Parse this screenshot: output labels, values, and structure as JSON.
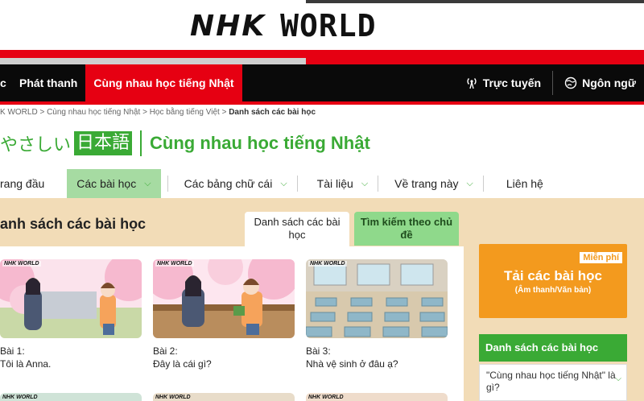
{
  "header": {
    "logo_nhk": "NHK",
    "logo_world": "WORLD"
  },
  "main_nav": {
    "items": [
      {
        "label": "c"
      },
      {
        "label": "Phát thanh"
      },
      {
        "label": "Cùng nhau học tiếng Nhật",
        "active": true
      }
    ],
    "live_label": "Trực tuyến",
    "language_label": "Ngôn ngữ"
  },
  "breadcrumb": {
    "items": [
      "K WORLD",
      "Cùng nhau học tiếng Nhật",
      "Học bằng tiếng Việt"
    ],
    "separator": ">",
    "current": "Danh sách các bài học"
  },
  "program": {
    "yasashii": "やさしい",
    "nihongo": "日本語",
    "name": "Cùng nhau học tiếng Nhật"
  },
  "sub_nav": {
    "items": [
      {
        "label": "rang đầu",
        "dropdown": false
      },
      {
        "label": "Các bài học",
        "dropdown": true,
        "active": true
      },
      {
        "label": "Các bảng chữ cái",
        "dropdown": true
      },
      {
        "label": "Tài liệu",
        "dropdown": true
      },
      {
        "label": "Về trang này",
        "dropdown": true
      },
      {
        "label": "Liên hệ",
        "dropdown": false
      }
    ]
  },
  "content": {
    "heading": "anh sách các bài học",
    "tabs": [
      {
        "label": "Danh sách các bài học",
        "active": true
      },
      {
        "label": "Tìm kiếm theo chủ đề",
        "active": false
      }
    ],
    "badge": "NHK WORLD",
    "lessons": [
      {
        "number": "Bài 1:",
        "title": "Tôi là Anna."
      },
      {
        "number": "Bài 2:",
        "title": "Đây là cái gì?"
      },
      {
        "number": "Bài 3:",
        "title": "Nhà vệ sinh ở đâu ạ?"
      }
    ]
  },
  "sidebar": {
    "free_badge": "Miễn phí",
    "download_title": "Tải các bài học",
    "download_sub": "(Âm thanh/Văn bản)",
    "list_title": "Danh sách các bài học",
    "link_text": "\"Cùng nhau học tiếng Nhật\" là gì?"
  },
  "colors": {
    "nhk_red": "#e60012",
    "green": "#3aaa35",
    "light_green": "#a6dba2",
    "orange": "#f39a1e",
    "tan": "#f2dcb7"
  }
}
